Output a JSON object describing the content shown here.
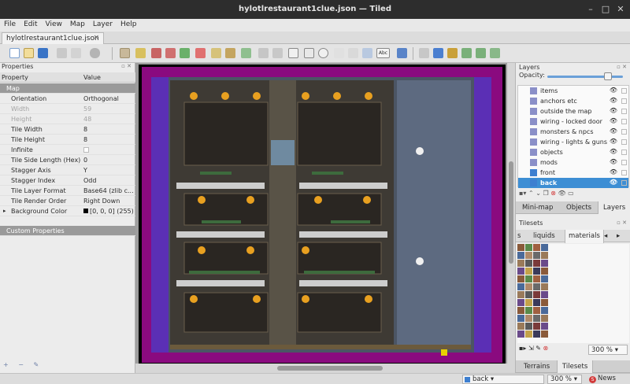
{
  "window": {
    "title": "hylotlrestaurant1clue.json — Tiled"
  },
  "menu": [
    "File",
    "Edit",
    "View",
    "Map",
    "Layer",
    "Help"
  ],
  "document_tab": {
    "label": "hylotlrestaurant1clue.json"
  },
  "properties_panel": {
    "title": "Properties",
    "columns": {
      "property": "Property",
      "value": "Value"
    },
    "section_map": "Map",
    "rows": [
      {
        "key": "Orientation",
        "value": "Orthogonal",
        "dim": false
      },
      {
        "key": "Width",
        "value": "59",
        "dim": true
      },
      {
        "key": "Height",
        "value": "48",
        "dim": true
      },
      {
        "key": "Tile Width",
        "value": "8",
        "dim": false
      },
      {
        "key": "Tile Height",
        "value": "8",
        "dim": false
      },
      {
        "key": "Infinite",
        "value": "",
        "dim": false
      },
      {
        "key": "Tile Side Length (Hex)",
        "value": "0",
        "dim": false
      },
      {
        "key": "Stagger Axis",
        "value": "Y",
        "dim": false
      },
      {
        "key": "Stagger Index",
        "value": "Odd",
        "dim": false
      },
      {
        "key": "Tile Layer Format",
        "value": "Base64 (zlib c...",
        "dim": false
      },
      {
        "key": "Tile Render Order",
        "value": "Right Down",
        "dim": false
      },
      {
        "key": "Background Color",
        "value": "[0, 0, 0] (255)",
        "dim": false
      }
    ],
    "section_custom": "Custom Properties"
  },
  "layers_panel": {
    "title": "Layers",
    "opacity_label": "Opacity:",
    "opacity": 0.8,
    "layers": [
      {
        "name": "items",
        "type": "object",
        "selected": false
      },
      {
        "name": "anchors etc",
        "type": "object",
        "selected": false
      },
      {
        "name": "outside the map",
        "type": "object",
        "selected": false
      },
      {
        "name": "wiring - locked door",
        "type": "object",
        "selected": false
      },
      {
        "name": "monsters & npcs",
        "type": "object",
        "selected": false
      },
      {
        "name": "wiring - lights & guns",
        "type": "object",
        "selected": false
      },
      {
        "name": "objects",
        "type": "object",
        "selected": false
      },
      {
        "name": "mods",
        "type": "object",
        "selected": false
      },
      {
        "name": "front",
        "type": "tile",
        "selected": false
      },
      {
        "name": "back",
        "type": "tile",
        "selected": true
      }
    ],
    "tabs": [
      "Mini-map",
      "Objects",
      "Layers"
    ],
    "active_tab": "Layers"
  },
  "tilesets_panel": {
    "title": "Tilesets",
    "tabs": [
      "s",
      "liquids",
      "materials"
    ],
    "active_tab": "materials",
    "zoom": "300 %",
    "bottom_tabs": [
      "Terrains",
      "Tilesets"
    ],
    "active_bottom_tab": "Tilesets"
  },
  "status_bar": {
    "layer": "back",
    "zoom": "300 %",
    "news": "News"
  },
  "colors": {
    "map_border": "#8a0a7f",
    "selection": "#3d8ed4"
  }
}
